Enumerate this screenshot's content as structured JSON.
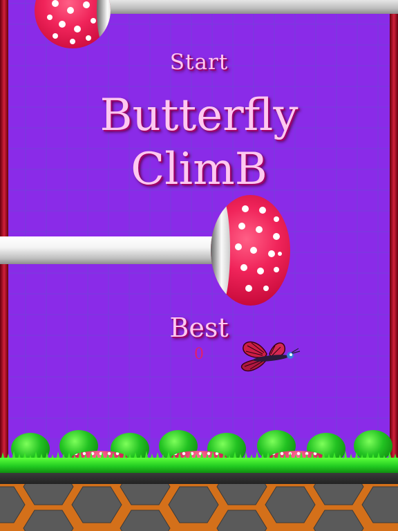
{
  "game": {
    "start_label": "Start",
    "title_line1": "Butterfly",
    "title_line2": "ClimB",
    "best_label": "Best",
    "best_score": "0"
  },
  "colors": {
    "background": "#8a2be8",
    "title_text": "#ffc8f0",
    "score_text": "#e0206a",
    "mushroom_cap": "#f0245a",
    "grass": "#22cc22",
    "ground_mortar": "#d4701a"
  },
  "icons": {
    "player": "butterfly-icon",
    "obstacle": "mushroom-icon"
  }
}
